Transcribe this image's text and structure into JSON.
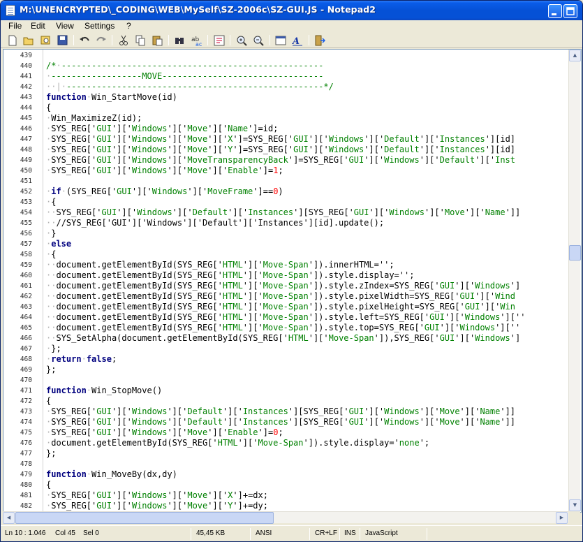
{
  "window": {
    "title": "M:\\UNENCRYPTED\\_CODING\\WEB\\MySelf\\SZ-2006c\\SZ-GUI.JS - Notepad2"
  },
  "menu": [
    "File",
    "Edit",
    "View",
    "Settings",
    "?"
  ],
  "toolbar": {
    "icons": [
      "new-file-icon",
      "open-folder-icon",
      "browse-icon",
      "save-icon",
      "undo-icon",
      "redo-icon",
      "cut-icon",
      "copy-icon",
      "paste-icon",
      "find-icon",
      "replace-icon",
      "word-wrap-icon",
      "zoom-in-icon",
      "zoom-out-icon",
      "select-scheme-icon",
      "font-icon",
      "exit-icon"
    ]
  },
  "code": {
    "lines": [
      {
        "n": "439",
        "t": ""
      },
      {
        "n": "440",
        "t": "/*·----------------------------------------------------"
      },
      {
        "n": "441",
        "t": "·------------------MOVE--------------------------------"
      },
      {
        "n": "442",
        "t": "··|·---------------------------------------------------*/"
      },
      {
        "n": "443",
        "t": "function·Win_StartMove(id)"
      },
      {
        "n": "444",
        "t": "{"
      },
      {
        "n": "445",
        "t": "·Win_MaximizeZ(id);"
      },
      {
        "n": "446",
        "t": "·SYS_REG['GUI']['Windows']['Move']['Name']=id;"
      },
      {
        "n": "447",
        "t": "·SYS_REG['GUI']['Windows']['Move']['X']=SYS_REG['GUI']['Windows']['Default']['Instances'][id]"
      },
      {
        "n": "448",
        "t": "·SYS_REG['GUI']['Windows']['Move']['Y']=SYS_REG['GUI']['Windows']['Default']['Instances'][id]"
      },
      {
        "n": "449",
        "t": "·SYS_REG['GUI']['Windows']['MoveTransparencyBack']=SYS_REG['GUI']['Windows']['Default']['Insta"
      },
      {
        "n": "450",
        "t": "·SYS_REG['GUI']['Windows']['Move']['Enable']=1;"
      },
      {
        "n": "451",
        "t": ""
      },
      {
        "n": "452",
        "t": "·if·(SYS_REG['GUI']['Windows']['MoveFrame']==0)"
      },
      {
        "n": "453",
        "t": "·{"
      },
      {
        "n": "454",
        "t": "··SYS_REG['GUI']['Windows']['Default']['Instances'][SYS_REG['GUI']['Windows']['Move']['Name']]"
      },
      {
        "n": "455",
        "t": "··//SYS_REG['GUI']['Windows']['Default']['Instances'][id].update();"
      },
      {
        "n": "456",
        "t": "·}"
      },
      {
        "n": "457",
        "t": "·else"
      },
      {
        "n": "458",
        "t": "·{"
      },
      {
        "n": "459",
        "t": "··document.getElementById(SYS_REG['HTML']['Move-Span']).innerHTML='';"
      },
      {
        "n": "460",
        "t": "··document.getElementById(SYS_REG['HTML']['Move-Span']).style.display='';"
      },
      {
        "n": "461",
        "t": "··document.getElementById(SYS_REG['HTML']['Move-Span']).style.zIndex=SYS_REG['GUI']['Windows']"
      },
      {
        "n": "462",
        "t": "··document.getElementById(SYS_REG['HTML']['Move-Span']).style.pixelWidth=SYS_REG['GUI']['Windo"
      },
      {
        "n": "463",
        "t": "··document.getElementById(SYS_REG['HTML']['Move-Span']).style.pixelHeight=SYS_REG['GUI']['Wind"
      },
      {
        "n": "464",
        "t": "··document.getElementById(SYS_REG['HTML']['Move-Span']).style.left=SYS_REG['GUI']['Windows']['"
      },
      {
        "n": "465",
        "t": "··document.getElementById(SYS_REG['HTML']['Move-Span']).style.top=SYS_REG['GUI']['Windows']['"
      },
      {
        "n": "466",
        "t": "··SYS_SetAlpha(document.getElementById(SYS_REG['HTML']['Move-Span']),SYS_REG['GUI']['Windows']"
      },
      {
        "n": "467",
        "t": "·};"
      },
      {
        "n": "468",
        "t": "·return·false;"
      },
      {
        "n": "469",
        "t": "};"
      },
      {
        "n": "470",
        "t": ""
      },
      {
        "n": "471",
        "t": "function·Win_StopMove()"
      },
      {
        "n": "472",
        "t": "{"
      },
      {
        "n": "473",
        "t": "·SYS_REG['GUI']['Windows']['Default']['Instances'][SYS_REG['GUI']['Windows']['Move']['Name']]"
      },
      {
        "n": "474",
        "t": "·SYS_REG['GUI']['Windows']['Default']['Instances'][SYS_REG['GUI']['Windows']['Move']['Name']]"
      },
      {
        "n": "475",
        "t": "·SYS_REG['GUI']['Windows']['Move']['Enable']=0;"
      },
      {
        "n": "476",
        "t": "·document.getElementById(SYS_REG['HTML']['Move-Span']).style.display='none';"
      },
      {
        "n": "477",
        "t": "};"
      },
      {
        "n": "478",
        "t": ""
      },
      {
        "n": "479",
        "t": "function·Win_MoveBy(dx,dy)"
      },
      {
        "n": "480",
        "t": "{"
      },
      {
        "n": "481",
        "t": "·SYS_REG['GUI']['Windows']['Move']['X']+=dx;"
      },
      {
        "n": "482",
        "t": "·SYS_REG['GUI']['Windows']['Move']['Y']+=dy;"
      }
    ]
  },
  "colors": {
    "keyword": "#00007f",
    "string": "#008000",
    "comment": "#008000",
    "number": "#ff0000",
    "text": "#000000",
    "dot": "#b0b0b0"
  },
  "status": {
    "position": "Ln 10 : 1.046",
    "column": "Col 45",
    "selection": "Sel 0",
    "size": "45,45 KB",
    "encoding": "ANSI",
    "line_endings": "CR+LF",
    "insert_mode": "INS",
    "scheme": "JavaScript"
  }
}
